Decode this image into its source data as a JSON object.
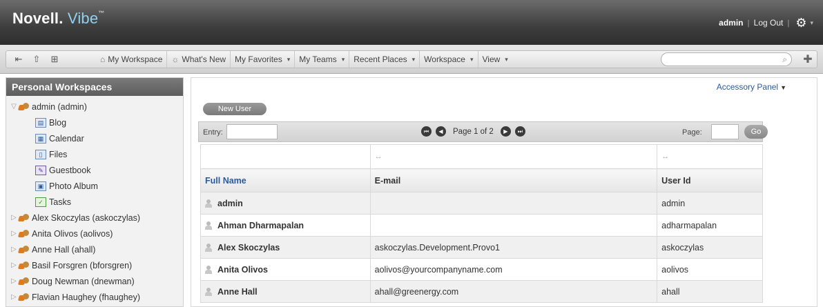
{
  "header": {
    "brand": "Novell.",
    "brand_product": "Vibe",
    "brand_tm": "™",
    "user": "admin",
    "sep": "|",
    "logout": "Log Out",
    "gear_icon": "gear-icon"
  },
  "toolbar": {
    "icons": [
      "back-icon",
      "upload-icon",
      "tree-icon"
    ],
    "menu": [
      {
        "label": "My Workspace",
        "icon": "house-icon"
      },
      {
        "label": "What's New",
        "icon": "sun-icon"
      },
      {
        "label": "My Favorites",
        "dropdown": true
      },
      {
        "label": "My Teams",
        "dropdown": true
      },
      {
        "label": "Recent Places",
        "dropdown": true
      },
      {
        "label": "Workspace",
        "dropdown": true
      },
      {
        "label": "View",
        "dropdown": true
      }
    ],
    "search_placeholder": ""
  },
  "sidebar": {
    "title": "Personal Workspaces",
    "root": "admin (admin)",
    "children": [
      "Blog",
      "Calendar",
      "Files",
      "Guestbook",
      "Photo Album",
      "Tasks"
    ],
    "people": [
      "Alex Skoczylas (askoczylas)",
      "Anita Olivos (aolivos)",
      "Anne Hall (ahall)",
      "Basil Forsgren (bforsgren)",
      "Doug Newman (dnewman)",
      "Flavian Haughey (fhaughey)"
    ]
  },
  "main": {
    "accessory_panel": "Accessory Panel",
    "new_user": "New User",
    "pager": {
      "entry_label": "Entry:",
      "page_text": "Page 1 of 2",
      "page_label": "Page:",
      "go": "Go"
    },
    "resize_glyph": "↔",
    "columns": [
      "Full Name",
      "E-mail",
      "User Id"
    ],
    "rows": [
      {
        "name": "admin",
        "email": "",
        "userid": "admin"
      },
      {
        "name": "Ahman Dharmapalan",
        "email": "",
        "userid": "adharmapalan"
      },
      {
        "name": "Alex Skoczylas",
        "email": "askoczylas.Development.Provo1",
        "userid": "askoczylas"
      },
      {
        "name": "Anita Olivos",
        "email": "aolivos@yourcompanyname.com",
        "userid": "aolivos"
      },
      {
        "name": "Anne Hall",
        "email": "ahall@greenergy.com",
        "userid": "ahall"
      }
    ]
  }
}
